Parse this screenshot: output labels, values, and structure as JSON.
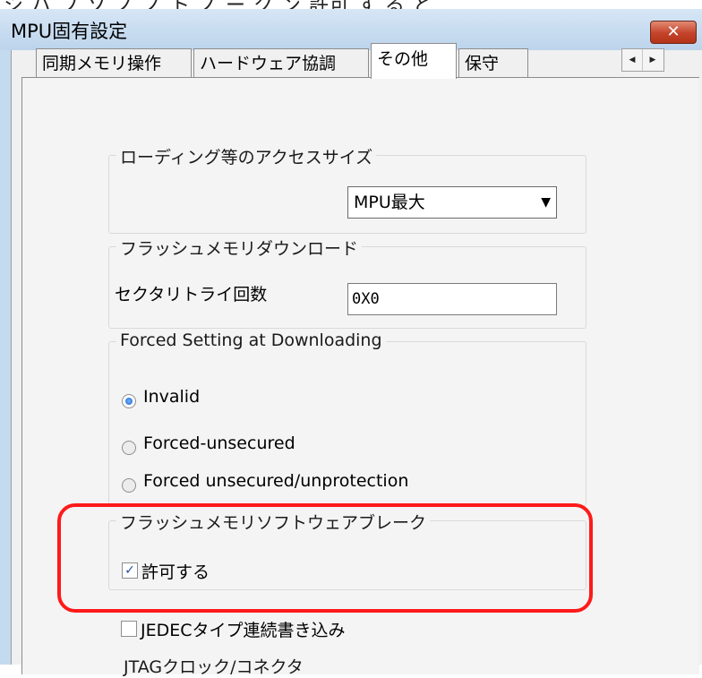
{
  "background_text": "シ ハ フ ソ  ノ ノ ト ノ  ー  ク ン  許可 す る  と ",
  "window": {
    "title": "MPU固有設定",
    "close_glyph": "✕"
  },
  "tabs": [
    {
      "label": "同期メモリ操作",
      "active": false
    },
    {
      "label": "ハードウェア協調",
      "active": false
    },
    {
      "label": "その他",
      "active": true
    },
    {
      "label": "保守",
      "active": false
    }
  ],
  "tab_scroll": {
    "left_glyph": "◀",
    "right_glyph": "▶"
  },
  "access_size": {
    "group_title": "ローディング等のアクセスサイズ",
    "selected": "MPU最大",
    "caret": "▼"
  },
  "flash_download": {
    "group_title": "フラッシュメモリダウンロード",
    "retry_label": "セクタリトライ回数",
    "retry_value": "0X0"
  },
  "forced_setting": {
    "group_title": "Forced Setting at Downloading",
    "options": [
      {
        "label": "Invalid",
        "selected": true
      },
      {
        "label": "Forced-unsecured",
        "selected": false
      },
      {
        "label": "Forced unsecured/unprotection",
        "selected": false
      }
    ]
  },
  "flash_software_break": {
    "group_title": "フラッシュメモリソフトウェアブレーク",
    "allow_label": "許可する",
    "allow_checked": true,
    "check_glyph": "✓",
    "jedec_label": "JEDECタイプ連続書き込み",
    "jedec_checked": false
  },
  "jtag_partial": "JTAGクロック/コネクタ",
  "highlight_color": "#ff1a1a"
}
